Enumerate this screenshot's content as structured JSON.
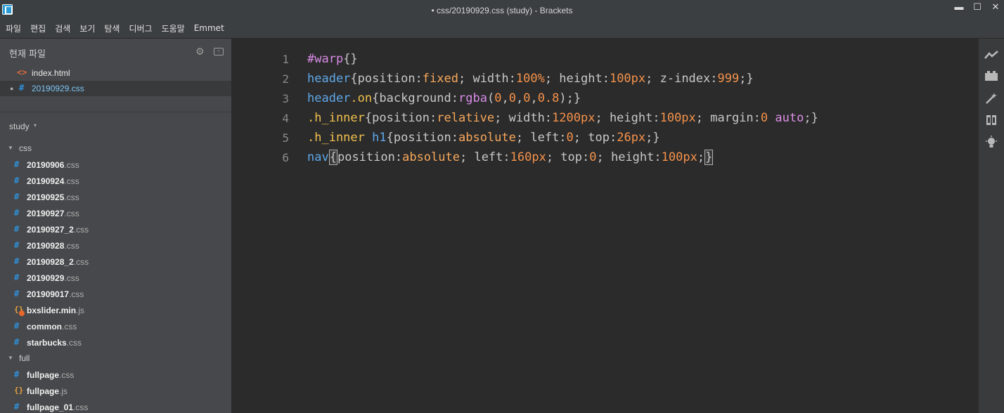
{
  "window": {
    "title": "• css/20190929.css (study) - Brackets",
    "minimize": "▬",
    "maximize": "☐",
    "close": "✕"
  },
  "menu": [
    "파일",
    "편집",
    "검색",
    "보기",
    "탐색",
    "디버그",
    "도움말",
    "Emmet"
  ],
  "working_files": {
    "title": "현재 파일",
    "items": [
      {
        "name": "index.html",
        "icon": "<>",
        "type": "html",
        "active": false,
        "dirty": false
      },
      {
        "name": "20190929.css",
        "icon": "#",
        "type": "css",
        "active": true,
        "dirty": true
      }
    ]
  },
  "project": {
    "name": "study",
    "caret": "▾"
  },
  "tree": [
    {
      "kind": "folder",
      "name": "css"
    },
    {
      "kind": "file",
      "base": "20190906",
      "ext": ".css",
      "type": "css"
    },
    {
      "kind": "file",
      "base": "20190924",
      "ext": ".css",
      "type": "css"
    },
    {
      "kind": "file",
      "base": "20190925",
      "ext": ".css",
      "type": "css"
    },
    {
      "kind": "file",
      "base": "20190927",
      "ext": ".css",
      "type": "css"
    },
    {
      "kind": "file",
      "base": "20190927_2",
      "ext": ".css",
      "type": "css"
    },
    {
      "kind": "file",
      "base": "20190928",
      "ext": ".css",
      "type": "css"
    },
    {
      "kind": "file",
      "base": "20190928_2",
      "ext": ".css",
      "type": "css"
    },
    {
      "kind": "file",
      "base": "20190929",
      "ext": ".css",
      "type": "css"
    },
    {
      "kind": "file",
      "base": "201909017",
      "ext": ".css",
      "type": "css"
    },
    {
      "kind": "file",
      "base": "bxslider.min",
      "ext": ".js",
      "type": "js",
      "warning": true
    },
    {
      "kind": "file",
      "base": "common",
      "ext": ".css",
      "type": "css"
    },
    {
      "kind": "file",
      "base": "starbucks",
      "ext": ".css",
      "type": "css"
    },
    {
      "kind": "folder",
      "name": "full"
    },
    {
      "kind": "file",
      "base": "fullpage",
      "ext": ".css",
      "type": "css"
    },
    {
      "kind": "file",
      "base": "fullpage",
      "ext": ".js",
      "type": "js"
    },
    {
      "kind": "file",
      "base": "fullpage_01",
      "ext": ".css",
      "type": "css"
    }
  ],
  "code_lines": [
    {
      "num": "1",
      "tokens": [
        [
          "sel",
          "#warp"
        ],
        [
          "brace",
          "{}"
        ]
      ]
    },
    {
      "num": "2",
      "tokens": [
        [
          "tag",
          "header"
        ],
        [
          "brace",
          "{"
        ],
        [
          "prop",
          "position:"
        ],
        [
          "val",
          "fixed"
        ],
        [
          "prop",
          "; width:"
        ],
        [
          "num",
          "100%"
        ],
        [
          "prop",
          "; height:"
        ],
        [
          "num",
          "100px"
        ],
        [
          "prop",
          "; z-index:"
        ],
        [
          "num",
          "999"
        ],
        [
          "prop",
          ";"
        ],
        [
          "brace",
          "}"
        ]
      ]
    },
    {
      "num": "3",
      "tokens": [
        [
          "tag",
          "header"
        ],
        [
          "cls",
          ".on"
        ],
        [
          "brace",
          "{"
        ],
        [
          "prop",
          "background:"
        ],
        [
          "fn",
          "rgba"
        ],
        [
          "prop",
          "("
        ],
        [
          "num",
          "0"
        ],
        [
          "prop",
          ","
        ],
        [
          "num",
          "0"
        ],
        [
          "prop",
          ","
        ],
        [
          "num",
          "0"
        ],
        [
          "prop",
          ","
        ],
        [
          "num",
          "0.8"
        ],
        [
          "prop",
          ");"
        ],
        [
          "brace",
          "}"
        ]
      ]
    },
    {
      "num": "4",
      "tokens": [
        [
          "cls",
          ".h_inner"
        ],
        [
          "brace",
          "{"
        ],
        [
          "prop",
          "position:"
        ],
        [
          "val",
          "relative"
        ],
        [
          "prop",
          "; width:"
        ],
        [
          "num",
          "1200px"
        ],
        [
          "prop",
          "; height:"
        ],
        [
          "num",
          "100px"
        ],
        [
          "prop",
          "; margin:"
        ],
        [
          "num",
          "0"
        ],
        [
          "prop",
          " "
        ],
        [
          "kw",
          "auto"
        ],
        [
          "prop",
          ";"
        ],
        [
          "brace",
          "}"
        ]
      ]
    },
    {
      "num": "5",
      "tokens": [
        [
          "cls",
          ".h_inner"
        ],
        [
          "prop",
          " "
        ],
        [
          "tag",
          "h1"
        ],
        [
          "brace",
          "{"
        ],
        [
          "prop",
          "position:"
        ],
        [
          "val",
          "absolute"
        ],
        [
          "prop",
          "; left:"
        ],
        [
          "num",
          "0"
        ],
        [
          "prop",
          "; top:"
        ],
        [
          "num",
          "26px"
        ],
        [
          "prop",
          ";"
        ],
        [
          "brace",
          "}"
        ]
      ]
    },
    {
      "num": "6",
      "tokens": [
        [
          "tag",
          "nav"
        ],
        [
          "match",
          "{"
        ],
        [
          "prop",
          "position:"
        ],
        [
          "val",
          "absolute"
        ],
        [
          "prop",
          "; left:"
        ],
        [
          "num",
          "160px"
        ],
        [
          "prop",
          "; top:"
        ],
        [
          "num",
          "0"
        ],
        [
          "prop",
          "; height:"
        ],
        [
          "num",
          "100px"
        ],
        [
          "prop",
          ";"
        ],
        [
          "match",
          "}"
        ]
      ]
    }
  ],
  "toolbar_icons": [
    "live-preview-icon",
    "extension-manager-icon",
    "emmet-wand-icon",
    "brackets-icon",
    "lightbulb-icon"
  ],
  "colors": {
    "editor_bg": "#2b2b2b",
    "sidebar_bg": "#47484b",
    "css_icon": "#2f8fd8",
    "js_icon": "#e8a33c"
  }
}
